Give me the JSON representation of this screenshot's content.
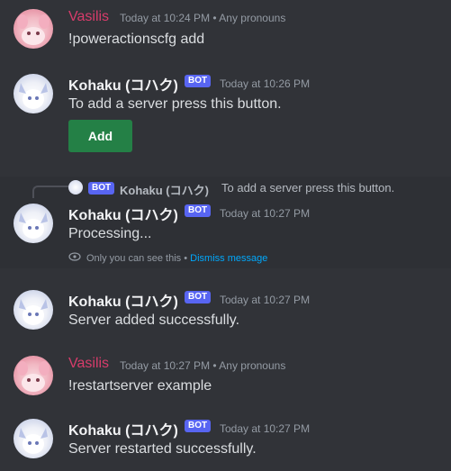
{
  "messages": [
    {
      "author": "Vasilis",
      "timestamp": "Today at 10:24 PM",
      "pronouns": "Any pronouns",
      "content": "!poweractionscfg add"
    },
    {
      "author": "Kohaku (コハク)",
      "badge": "BOT",
      "timestamp": "Today at 10:26 PM",
      "content": "To add a server press this button.",
      "button_label": "Add"
    },
    {
      "reply": {
        "badge": "BOT",
        "author": "Kohaku (コハク)",
        "content": "To add a server press this button."
      },
      "author": "Kohaku (コハク)",
      "badge": "BOT",
      "timestamp": "Today at 10:27 PM",
      "content": "Processing...",
      "ephemeral_text": "Only you can see this",
      "dismiss_label": "Dismiss message"
    },
    {
      "author": "Kohaku (コハク)",
      "badge": "BOT",
      "timestamp": "Today at 10:27 PM",
      "content": "Server added successfully."
    },
    {
      "author": "Vasilis",
      "timestamp": "Today at 10:27 PM",
      "pronouns": "Any pronouns",
      "content": "!restartserver example"
    },
    {
      "author": "Kohaku (コハク)",
      "badge": "BOT",
      "timestamp": "Today at 10:27 PM",
      "content": "Server restarted successfully."
    }
  ],
  "separator": "•",
  "colors": {
    "background": "#313338",
    "highlight": "#2e3035",
    "vasilis_name": "#d83c6b",
    "bot_badge": "#5865f2",
    "add_button": "#248046",
    "link": "#00a8fc"
  }
}
